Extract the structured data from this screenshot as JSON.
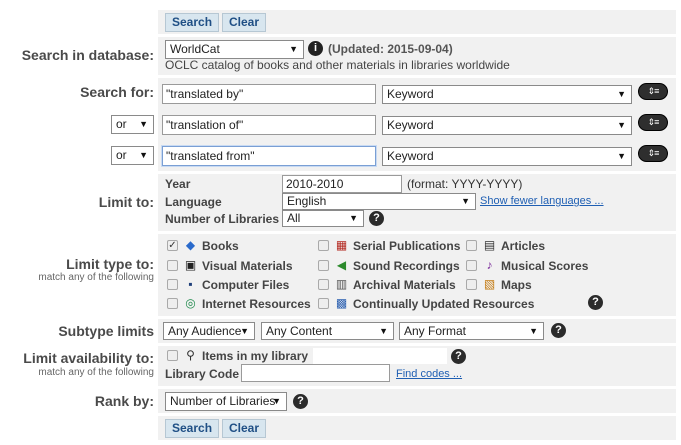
{
  "buttons": {
    "search": "Search",
    "clear": "Clear"
  },
  "database": {
    "label": "Search in database:",
    "selected": "WorldCat",
    "info_icon": "info-icon",
    "updated": "(Updated: 2015-09-04)",
    "description": "OCLC catalog of books and other materials in libraries worldwide"
  },
  "search_for": {
    "label": "Search for:",
    "rows": [
      {
        "operator": "",
        "value": "\"translated by\"",
        "field": "Keyword"
      },
      {
        "operator": "or",
        "value": "\"translation of\"",
        "field": "Keyword"
      },
      {
        "operator": "or",
        "value": "\"translated from\"",
        "field": "Keyword"
      }
    ]
  },
  "limit_to": {
    "label": "Limit to:",
    "year_label": "Year",
    "year_value": "2010-2010",
    "year_format": "(format: YYYY-YYYY)",
    "language_label": "Language",
    "language_value": "English",
    "fewer_languages": "Show fewer languages ...",
    "libraries_label": "Number of Libraries",
    "libraries_value": "All"
  },
  "limit_type": {
    "label": "Limit type to:",
    "sublabel": "match any of the following",
    "items": [
      {
        "label": "Books",
        "checked": true,
        "icon": "book-icon"
      },
      {
        "label": "Serial Publications",
        "checked": false,
        "icon": "serial-icon"
      },
      {
        "label": "Articles",
        "checked": false,
        "icon": "article-icon"
      },
      {
        "label": "Visual Materials",
        "checked": false,
        "icon": "camera-icon"
      },
      {
        "label": "Sound Recordings",
        "checked": false,
        "icon": "speaker-icon"
      },
      {
        "label": "Musical Scores",
        "checked": false,
        "icon": "score-icon"
      },
      {
        "label": "Computer Files",
        "checked": false,
        "icon": "floppy-icon"
      },
      {
        "label": "Archival Materials",
        "checked": false,
        "icon": "archive-icon"
      },
      {
        "label": "Maps",
        "checked": false,
        "icon": "map-icon"
      },
      {
        "label": "Internet Resources",
        "checked": false,
        "icon": "globe-icon"
      },
      {
        "label": "Continually Updated Resources",
        "checked": false,
        "icon": "update-icon"
      }
    ]
  },
  "subtype": {
    "label": "Subtype limits",
    "audience": "Any Audience",
    "content": "Any Content",
    "format": "Any Format"
  },
  "availability": {
    "label": "Limit availability to:",
    "sublabel": "match any of the following",
    "items_label": "Items in my library",
    "library_code_label": "Library Code",
    "library_code_value": "",
    "find_codes": "Find codes ..."
  },
  "rank": {
    "label": "Rank by:",
    "value": "Number of Libraries"
  },
  "icons": {
    "help": "?",
    "row_action": "row-options-icon",
    "dropdown": "▼"
  }
}
